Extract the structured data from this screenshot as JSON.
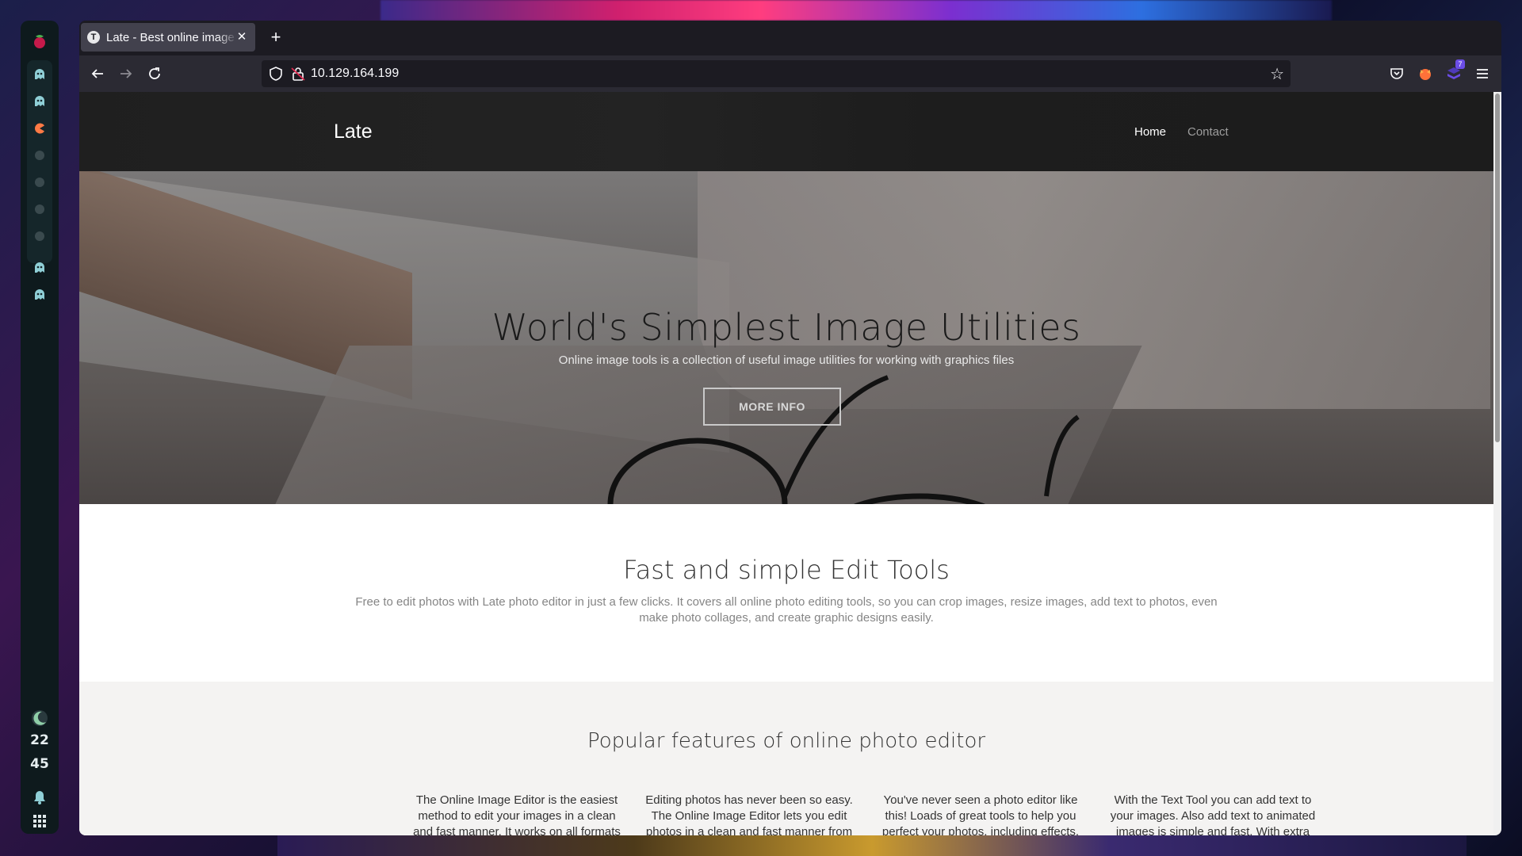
{
  "dock": {
    "clock_hours": "22",
    "clock_minutes": "45"
  },
  "browser": {
    "tab_title": "Late - Best online image t",
    "tab_favicon": "T",
    "url": "10.129.164.199",
    "extension_badge": "7"
  },
  "site": {
    "brand": "Late",
    "menu": {
      "home": "Home",
      "contact": "Contact"
    },
    "hero": {
      "title": "World's Simplest Image Utilities",
      "subtitle": "Online image tools is a collection of useful image utilities for working with graphics files",
      "button": "MORE INFO"
    },
    "tools": {
      "title": "Fast and simple Edit Tools",
      "text": "Free to edit photos with Late photo editor in just a few clicks. It covers all online photo editing tools, so you can crop images, resize images, add text to photos, even make photo collages, and create graphic designs easily."
    },
    "features": {
      "title": "Popular features of online photo editor",
      "columns": [
        "The Online Image Editor is the easiest method to edit your images in a clean and fast manner. It works on all formats like:",
        "Editing photos has never been so easy. The Online Image Editor lets you edit photos in a clean and fast manner from",
        "You've never seen a photo editor like this! Loads of great tools to help you perfect your photos, including effects, background",
        "With the Text Tool you can add text to your images. Also add text to animated images is simple and fast. With extra"
      ]
    }
  },
  "colors": {
    "site_header": "#1f1f1f",
    "menu_active": "#ffffff",
    "menu_inactive": "#9d9d9d",
    "features_bg": "#f4f3f2",
    "browser_chrome": "#2b2a33"
  }
}
